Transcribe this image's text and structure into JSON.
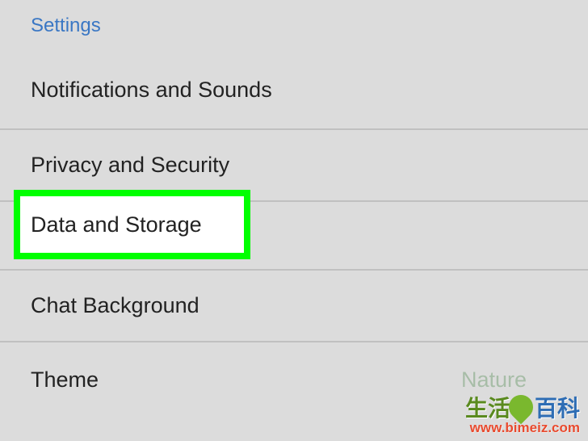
{
  "header": {
    "title": "Settings"
  },
  "menu": {
    "items": [
      {
        "label": "Notifications and Sounds"
      },
      {
        "label": "Privacy and Security"
      },
      {
        "label": "Data and Storage"
      },
      {
        "label": "Chat Background"
      },
      {
        "label": "Theme",
        "value": "Nature"
      }
    ]
  },
  "highlight": {
    "label": "Data and Storage"
  },
  "watermark": {
    "cn1": "生活",
    "cn2": "百科",
    "url": "www.bimeiz.com"
  }
}
